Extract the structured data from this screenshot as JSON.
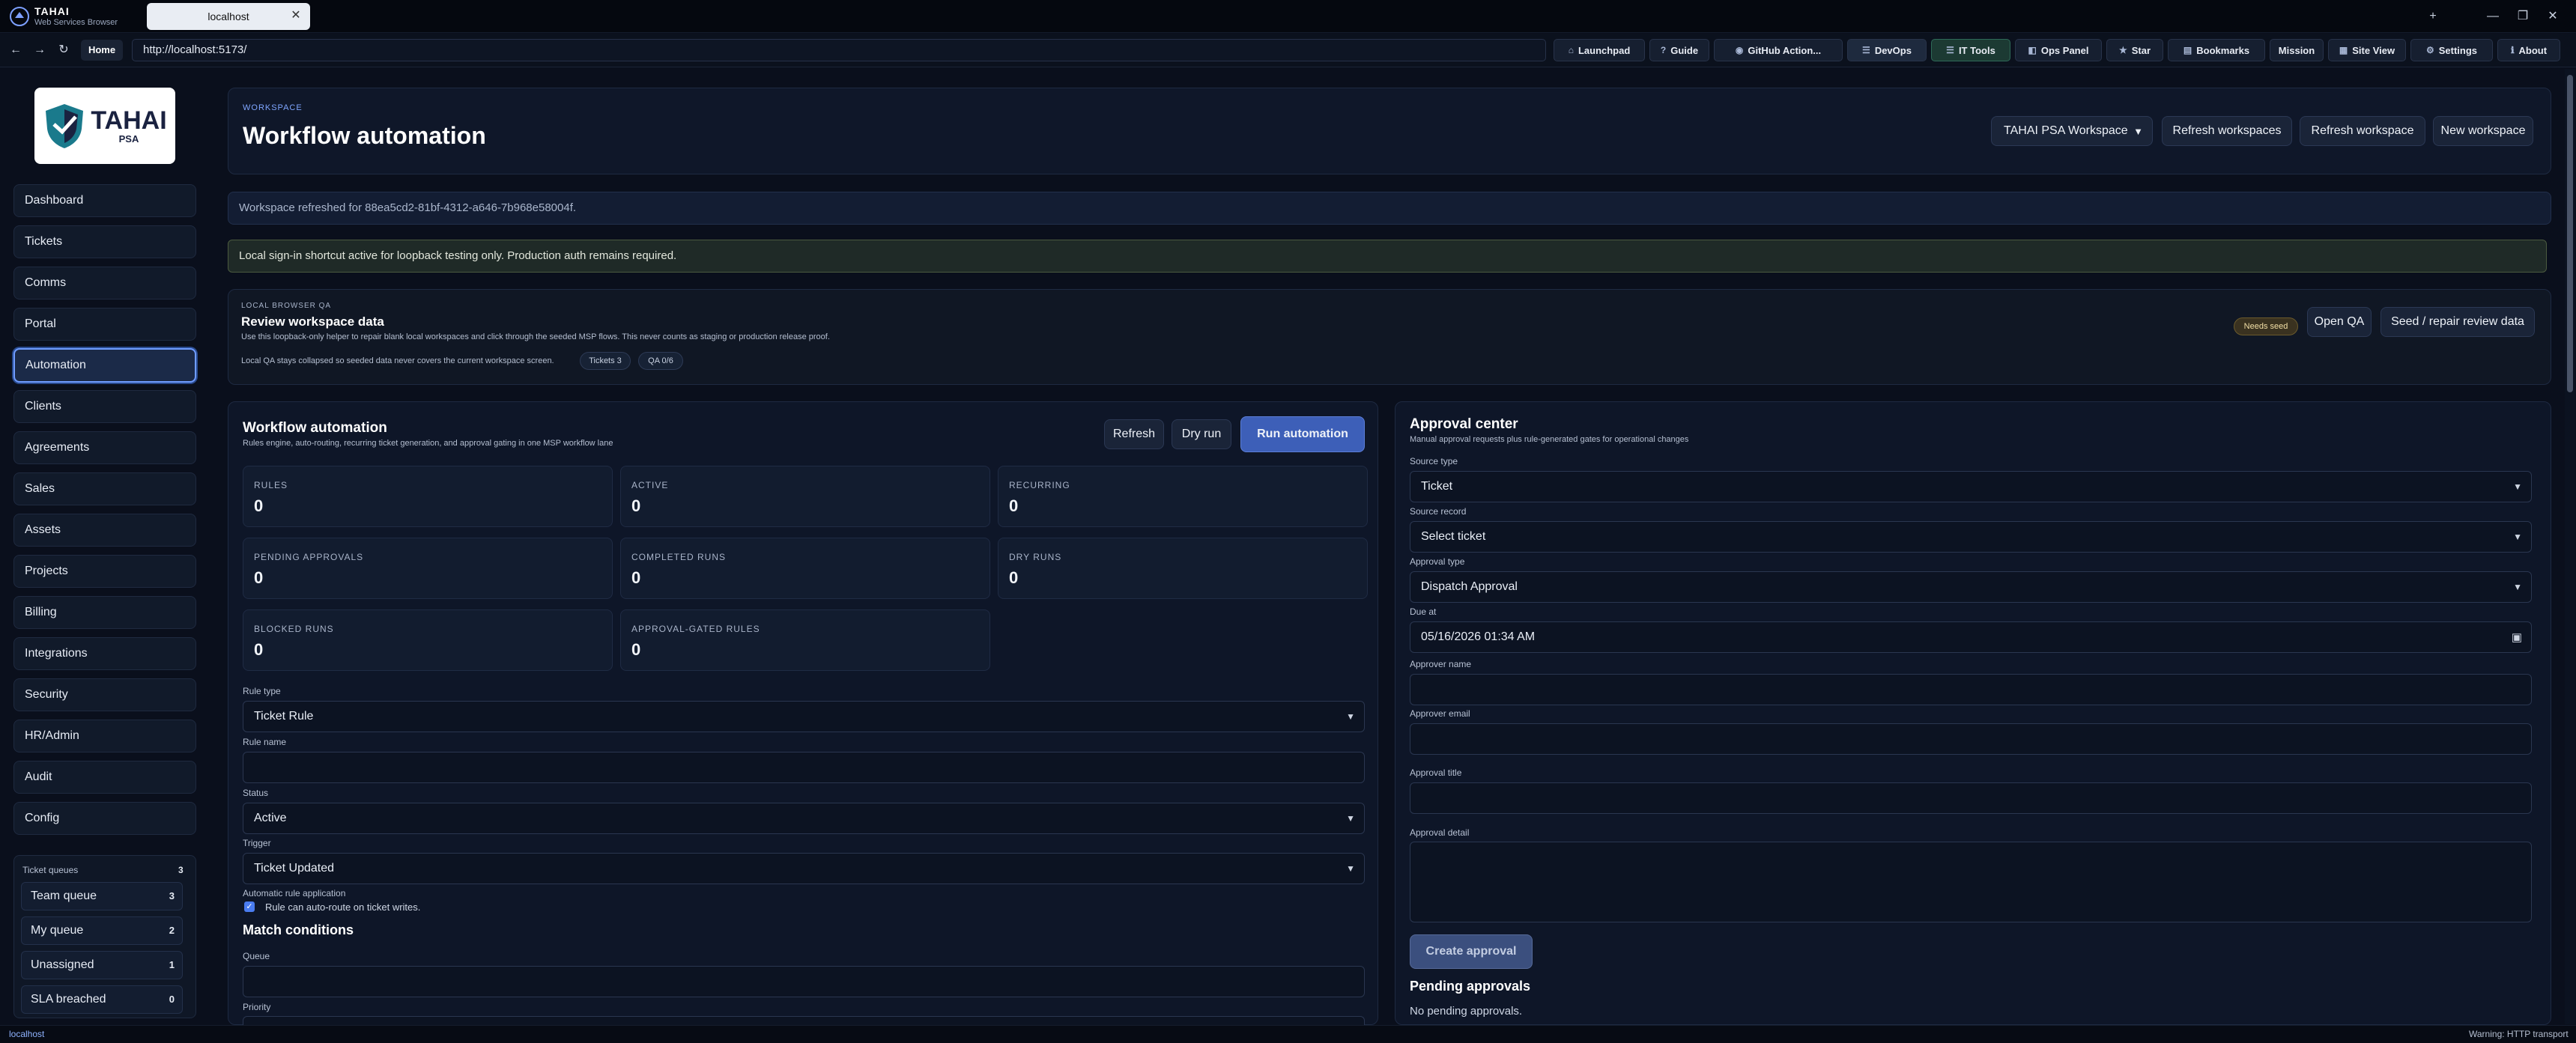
{
  "browser": {
    "brand_name": "TAHAI",
    "brand_sub": "Web Services Browser",
    "tab_title": "localhost",
    "url": "http://localhost:5173/",
    "home_label": "Home",
    "toolbar": [
      {
        "label": "Launchpad",
        "icon": "⌂"
      },
      {
        "label": "Guide",
        "icon": "?"
      },
      {
        "label": "GitHub Action...",
        "icon": "◉"
      },
      {
        "label": "DevOps",
        "icon": "☰"
      },
      {
        "label": "IT Tools",
        "icon": "☰"
      },
      {
        "label": "Ops Panel",
        "icon": "◧"
      },
      {
        "label": "Star",
        "icon": "★"
      },
      {
        "label": "Bookmarks",
        "icon": "▤"
      },
      {
        "label": "Mission",
        "icon": ""
      },
      {
        "label": "Site View",
        "icon": "▦"
      },
      {
        "label": "Settings",
        "icon": "⚙"
      },
      {
        "label": "About",
        "icon": "ℹ"
      }
    ],
    "status_left": "localhost",
    "status_right": "Warning: HTTP transport"
  },
  "sidebar": {
    "logo_title": "TAHAI",
    "logo_sub": "PSA",
    "items": [
      "Dashboard",
      "Tickets",
      "Comms",
      "Portal",
      "Automation",
      "Clients",
      "Agreements",
      "Sales",
      "Assets",
      "Projects",
      "Billing",
      "Integrations",
      "Security",
      "HR/Admin",
      "Audit",
      "Config"
    ],
    "active": "Automation",
    "queues": {
      "title": "Ticket queues",
      "count": "3",
      "items": [
        {
          "label": "Team queue",
          "count": "3"
        },
        {
          "label": "My queue",
          "count": "2"
        },
        {
          "label": "Unassigned",
          "count": "1"
        },
        {
          "label": "SLA breached",
          "count": "0"
        }
      ]
    }
  },
  "header": {
    "eyebrow": "WORKSPACE",
    "title": "Workflow automation",
    "workspace_select": "TAHAI PSA Workspace",
    "btn_refresh_workspaces": "Refresh workspaces",
    "btn_refresh_workspace": "Refresh workspace",
    "btn_new_workspace": "New workspace"
  },
  "notices": {
    "refreshed": "Workspace refreshed for 88ea5cd2-81bf-4312-a646-7b968e58004f.",
    "signin": "Local sign-in shortcut active for loopback testing only. Production auth remains required."
  },
  "qa": {
    "eyebrow": "LOCAL BROWSER QA",
    "title": "Review workspace data",
    "desc": "Use this loopback-only helper to repair blank local workspaces and click through the seeded MSP flows. This never counts as staging or production release proof.",
    "note": "Local QA stays collapsed so seeded data never covers the current workspace screen.",
    "pill_tickets": "Tickets 3",
    "pill_qa": "QA 0/6",
    "badge": "Needs seed",
    "btn_open": "Open QA",
    "btn_seed": "Seed / repair review data"
  },
  "automation": {
    "title": "Workflow automation",
    "subtitle": "Rules engine, auto-routing, recurring ticket generation, and approval gating in one MSP workflow lane",
    "btn_refresh": "Refresh",
    "btn_dry": "Dry run",
    "btn_run": "Run automation",
    "stats": [
      {
        "label": "RULES",
        "value": "0"
      },
      {
        "label": "ACTIVE",
        "value": "0"
      },
      {
        "label": "RECURRING",
        "value": "0"
      },
      {
        "label": "PENDING APPROVALS",
        "value": "0"
      },
      {
        "label": "COMPLETED RUNS",
        "value": "0"
      },
      {
        "label": "DRY RUNS",
        "value": "0"
      },
      {
        "label": "BLOCKED RUNS",
        "value": "0"
      },
      {
        "label": "APPROVAL-GATED RULES",
        "value": "0"
      }
    ],
    "rule_type_label": "Rule type",
    "rule_type_value": "Ticket Rule",
    "rule_name_label": "Rule name",
    "rule_name_value": "",
    "status_label": "Status",
    "status_value": "Active",
    "trigger_label": "Trigger",
    "trigger_value": "Ticket Updated",
    "auto_label": "Automatic rule application",
    "auto_check": "Rule can auto-route on ticket writes.",
    "match_title": "Match conditions",
    "queue_label": "Queue",
    "priority_label": "Priority"
  },
  "approval": {
    "title": "Approval center",
    "subtitle": "Manual approval requests plus rule-generated gates for operational changes",
    "source_type_label": "Source type",
    "source_type_value": "Ticket",
    "source_record_label": "Source record",
    "source_record_value": "Select ticket",
    "approval_type_label": "Approval type",
    "approval_type_value": "Dispatch Approval",
    "due_label": "Due at",
    "due_value": "05/16/2026 01:34 AM",
    "approver_name_label": "Approver name",
    "approver_email_label": "Approver email",
    "approval_title_label": "Approval title",
    "approval_detail_label": "Approval detail",
    "btn_create": "Create approval",
    "pending_title": "Pending approvals",
    "pending_empty": "No pending approvals."
  }
}
